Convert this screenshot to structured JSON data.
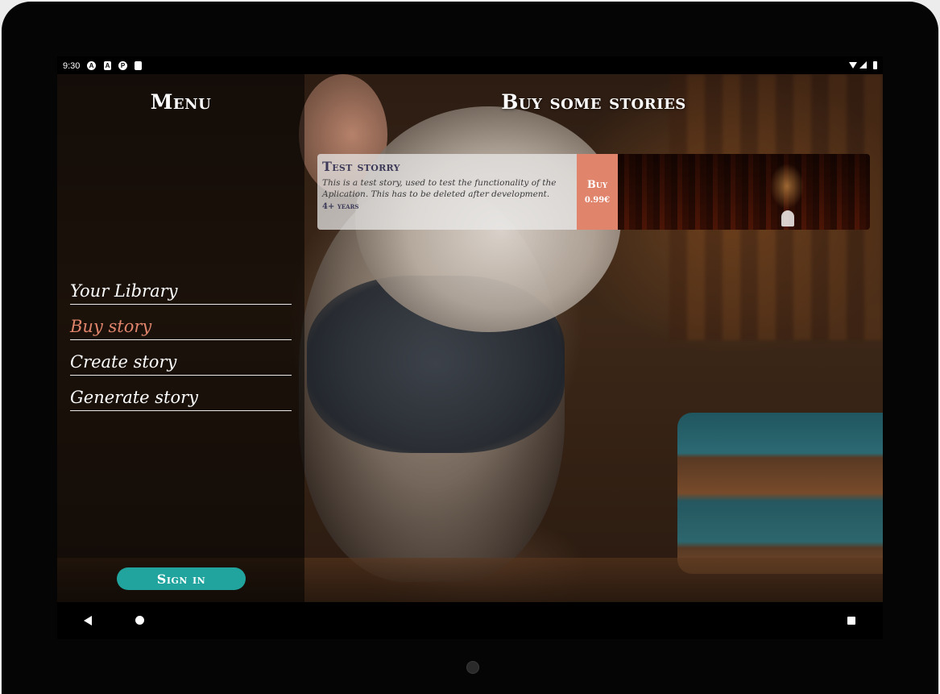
{
  "status_bar": {
    "time": "9:30",
    "notification_icons": [
      "A",
      "A",
      "P",
      ""
    ]
  },
  "menu": {
    "title": "Menu",
    "items": [
      {
        "label": "Your Library",
        "active": false
      },
      {
        "label": "Buy story",
        "active": true
      },
      {
        "label": "Create story",
        "active": false
      },
      {
        "label": "Generate story",
        "active": false
      }
    ],
    "sign_in_label": "Sign in"
  },
  "main": {
    "title": "Buy some stories",
    "stories": [
      {
        "title": "Test storry",
        "description": "This is a test story, used to test the functionality of the Aplication. This has to be deleted after development.",
        "age": "4+ years",
        "buy_label": "Buy",
        "price": "0.99€"
      }
    ]
  },
  "colors": {
    "accent": "#e0846c",
    "sign_in": "#21a49e",
    "story_title": "#3c3a58"
  }
}
